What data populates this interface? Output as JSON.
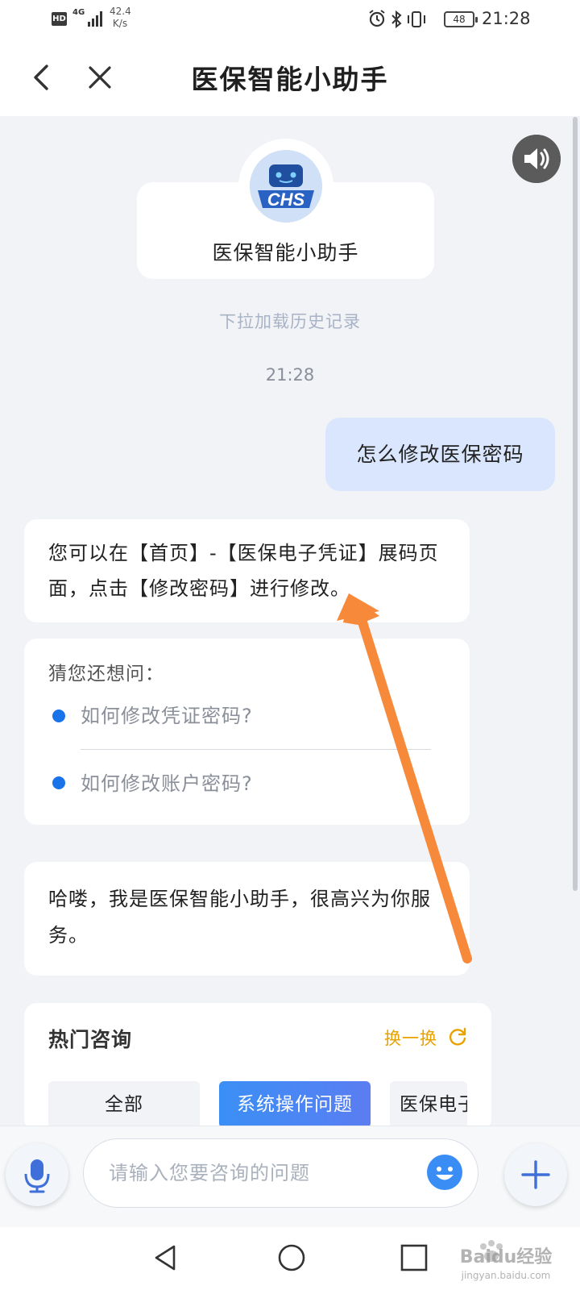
{
  "status_bar": {
    "hd": "HD",
    "network": "4G",
    "speed_value": "42.4",
    "speed_unit": "K/s",
    "battery": "48",
    "time": "21:28"
  },
  "header": {
    "title": "医保智能小助手"
  },
  "bot": {
    "avatar_text": "CHS",
    "name": "医保智能小助手"
  },
  "chat": {
    "history_hint": "下拉加载历史记录",
    "time": "21:28",
    "user_message": "怎么修改医保密码",
    "bot_answer": "您可以在【首页】-【医保电子凭证】展码页面，点击【修改密码】进行修改。",
    "suggestions": {
      "title": "猜您还想问：",
      "items": [
        "如何修改凭证密码?",
        "如何修改账户密码?"
      ]
    },
    "greeting": "哈喽，我是医保智能小助手，很高兴为你服务。"
  },
  "hot": {
    "title": "热门咨询",
    "switch_label": "换一换",
    "categories": [
      "全部",
      "系统操作问题",
      "医保电子凭证"
    ]
  },
  "input": {
    "placeholder": "请输入您要咨询的问题",
    "value": ""
  },
  "watermark": {
    "brand": "Baidu经验",
    "url": "jingyan.baidu.com"
  },
  "colors": {
    "accent_blue": "#1a73e8",
    "user_bubble": "#d9e6fd",
    "switch_orange": "#e8a200",
    "annotation_arrow": "#f7893b"
  }
}
